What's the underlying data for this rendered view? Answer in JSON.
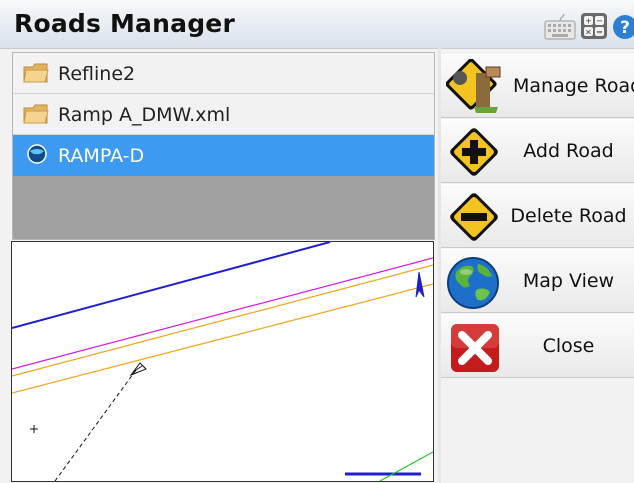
{
  "window": {
    "title": "Roads Manager"
  },
  "titlebar_icons": [
    "keyboard-icon",
    "calculator-icon",
    "help-icon"
  ],
  "roads_list": {
    "items": [
      {
        "label": "Refline2",
        "icon": "folder-icon",
        "selected": false
      },
      {
        "label": "Ramp A_DMW.xml",
        "icon": "folder-icon",
        "selected": false
      },
      {
        "label": "RAMPA-D",
        "icon": "globe-road-icon",
        "selected": true
      }
    ]
  },
  "buttons": {
    "manage": {
      "label": "Manage Road",
      "icon": "manage-road-icon"
    },
    "add": {
      "label": "Add Road",
      "icon": "add-road-sign-icon"
    },
    "delete": {
      "label": "Delete Road",
      "icon": "delete-road-sign-icon"
    },
    "map": {
      "label": "Map View",
      "icon": "globe-icon"
    },
    "close": {
      "label": "Close",
      "icon": "close-x-icon"
    }
  },
  "colors": {
    "selection": "#3d9af0",
    "alignment_blue": "#1f1fcf",
    "alignment_magenta": "#d21bd6",
    "alignment_orange": "#f0a51c",
    "alignment_green": "#27c427"
  }
}
